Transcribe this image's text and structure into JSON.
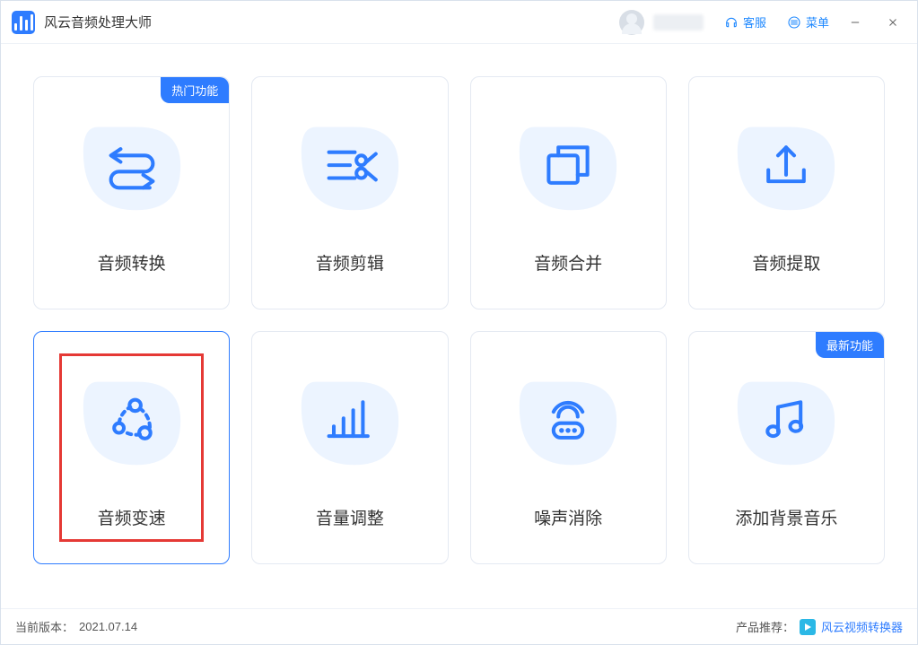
{
  "app": {
    "title": "风云音频处理大师"
  },
  "titlebar": {
    "customer_service": "客服",
    "menu": "菜单"
  },
  "badges": {
    "hot": "热门功能",
    "new": "最新功能"
  },
  "cards": [
    {
      "label": "音频转换",
      "icon": "convert-icon",
      "badge": "hot",
      "selected": false
    },
    {
      "label": "音频剪辑",
      "icon": "cut-icon",
      "badge": null,
      "selected": false
    },
    {
      "label": "音频合并",
      "icon": "merge-icon",
      "badge": null,
      "selected": false
    },
    {
      "label": "音频提取",
      "icon": "extract-icon",
      "badge": null,
      "selected": false
    },
    {
      "label": "音频变速",
      "icon": "speed-icon",
      "badge": null,
      "selected": true,
      "highlighted": true
    },
    {
      "label": "音量调整",
      "icon": "volume-icon",
      "badge": null,
      "selected": false
    },
    {
      "label": "噪声消除",
      "icon": "denoise-icon",
      "badge": null,
      "selected": false
    },
    {
      "label": "添加背景音乐",
      "icon": "bgmusic-icon",
      "badge": "new",
      "selected": false
    }
  ],
  "footer": {
    "version_label": "当前版本：",
    "version_value": "2021.07.14",
    "recommend_label": "产品推荐：",
    "recommend_product": "风云视频转换器"
  }
}
